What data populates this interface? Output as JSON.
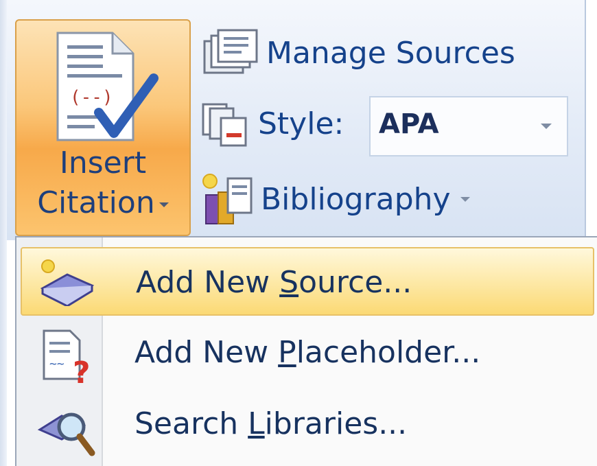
{
  "ribbon": {
    "insert_citation": {
      "line1": "Insert",
      "line2": "Citation"
    },
    "manage_sources": "Manage Sources",
    "style_label": "Style:",
    "style_value": "APA",
    "bibliography": "Bibliography"
  },
  "menu": {
    "items": [
      {
        "pre": "Add New ",
        "key": "S",
        "post": "ource...",
        "icon": "new-source-book-icon",
        "highlighted": true
      },
      {
        "pre": "Add New ",
        "key": "P",
        "post": "laceholder...",
        "icon": "placeholder-document-question-icon",
        "highlighted": false
      },
      {
        "pre": "Search ",
        "key": "L",
        "post": "ibraries...",
        "icon": "search-libraries-magnifier-icon",
        "highlighted": false
      }
    ]
  },
  "colors": {
    "accent_orange": "#f7a94a",
    "menu_highlight": "#fbd974",
    "text_blue": "#15428b"
  }
}
